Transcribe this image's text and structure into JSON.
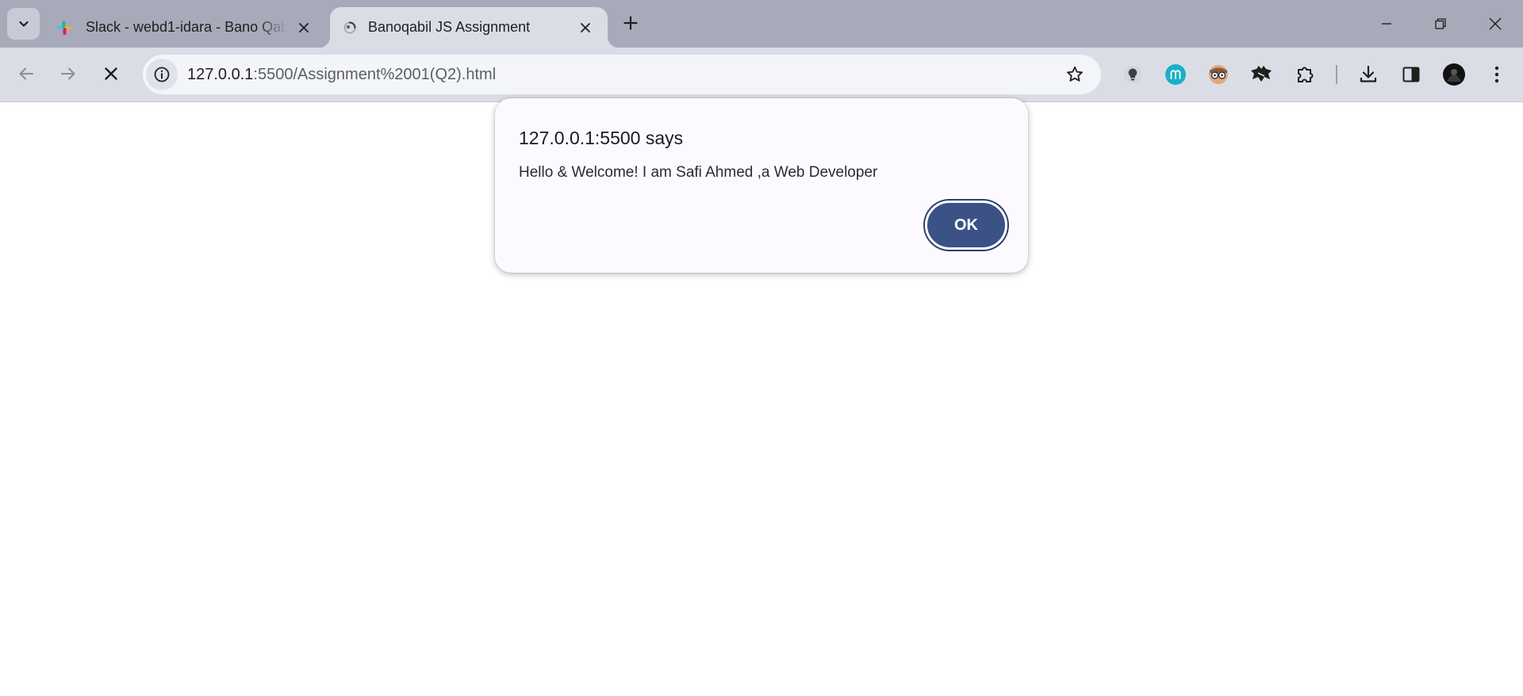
{
  "browser": {
    "tabs": [
      {
        "title": "Slack - webd1-idara - Bano Qabil",
        "favicon": "slack-icon",
        "active": false
      },
      {
        "title": "Banoqabil JS Assignment",
        "favicon": "loading-spinner-icon",
        "active": true
      }
    ],
    "address_bar": {
      "url_host": "127.0.0.1",
      "url_rest": ":5500/Assignment%2001(Q2).html"
    },
    "toolbar_icons": [
      "tab-search-icon",
      "back-icon",
      "forward-icon",
      "stop-loading-icon",
      "site-info-icon",
      "bookmark-star-icon",
      "lightbulb-extension-icon",
      "m-extension-icon",
      "glasses-extension-icon",
      "bat-extension-icon",
      "extensions-puzzle-icon",
      "downloads-icon",
      "side-panel-icon",
      "profile-avatar-icon",
      "menu-kebab-icon",
      "new-tab-icon",
      "minimize-icon",
      "restore-icon",
      "close-window-icon"
    ]
  },
  "dialog": {
    "title": "127.0.0.1:5500 says",
    "message": "Hello & Welcome! I am Safi Ahmed ,a Web Developer",
    "ok_label": "OK"
  },
  "colors": {
    "tabstrip": "#a7abb9",
    "toolbar": "#dadde6",
    "ok_button": "#3b5286",
    "m_extension": "#1ab0c4"
  }
}
